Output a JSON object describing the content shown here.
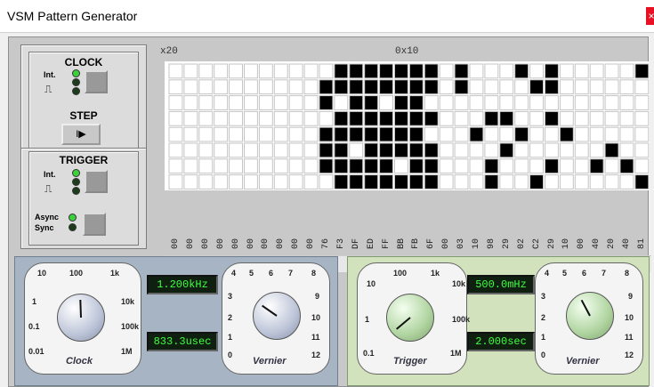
{
  "window": {
    "title": "VSM Pattern Generator",
    "close_glyph": "×"
  },
  "clock": {
    "title": "CLOCK",
    "int_label": "Int.",
    "step_label": "STEP",
    "step_glyph": "I▶"
  },
  "trigger": {
    "title": "TRIGGER",
    "int_label": "Int.",
    "async_label": "Async",
    "sync_label": "Sync"
  },
  "grid": {
    "left_label": "x20",
    "center_label": "0x10",
    "hex_columns": [
      "00",
      "00",
      "00",
      "00",
      "00",
      "00",
      "00",
      "00",
      "00",
      "00",
      "76",
      "F3",
      "DF",
      "ED",
      "FF",
      "BB",
      "FB",
      "6F",
      "00",
      "03",
      "10",
      "98",
      "29",
      "02",
      "C2",
      "29",
      "10",
      "00",
      "40",
      "20",
      "40",
      "81"
    ],
    "rows": 8,
    "cells": [
      [
        0,
        0,
        0,
        0,
        0,
        0,
        0,
        0,
        0,
        0,
        0,
        1,
        1,
        1,
        1,
        1,
        1,
        1,
        0,
        1,
        0,
        0,
        0,
        1,
        0,
        1,
        0,
        0,
        0,
        0,
        0,
        1
      ],
      [
        0,
        0,
        0,
        0,
        0,
        0,
        0,
        0,
        0,
        0,
        1,
        1,
        1,
        1,
        1,
        1,
        1,
        1,
        0,
        1,
        0,
        0,
        0,
        0,
        1,
        1,
        0,
        0,
        0,
        0,
        0,
        0
      ],
      [
        0,
        0,
        0,
        0,
        0,
        0,
        0,
        0,
        0,
        0,
        1,
        0,
        1,
        1,
        0,
        1,
        1,
        0,
        0,
        0,
        0,
        0,
        0,
        0,
        0,
        0,
        0,
        0,
        0,
        0,
        0,
        0
      ],
      [
        0,
        0,
        0,
        0,
        0,
        0,
        0,
        0,
        0,
        0,
        0,
        1,
        1,
        1,
        1,
        1,
        1,
        1,
        0,
        0,
        0,
        1,
        1,
        0,
        0,
        1,
        0,
        0,
        0,
        0,
        0,
        0
      ],
      [
        0,
        0,
        0,
        0,
        0,
        0,
        0,
        0,
        0,
        0,
        1,
        1,
        1,
        1,
        1,
        1,
        1,
        0,
        0,
        0,
        1,
        0,
        0,
        1,
        0,
        0,
        1,
        0,
        0,
        0,
        0,
        0
      ],
      [
        0,
        0,
        0,
        0,
        0,
        0,
        0,
        0,
        0,
        0,
        1,
        1,
        0,
        1,
        1,
        1,
        1,
        1,
        0,
        0,
        0,
        0,
        1,
        0,
        0,
        0,
        0,
        0,
        0,
        1,
        0,
        0
      ],
      [
        0,
        0,
        0,
        0,
        0,
        0,
        0,
        0,
        0,
        0,
        1,
        1,
        1,
        1,
        1,
        0,
        1,
        1,
        0,
        0,
        0,
        1,
        0,
        0,
        0,
        1,
        0,
        0,
        1,
        0,
        1,
        0
      ],
      [
        0,
        0,
        0,
        0,
        0,
        0,
        0,
        0,
        0,
        0,
        0,
        1,
        1,
        1,
        1,
        1,
        1,
        1,
        0,
        0,
        0,
        1,
        0,
        0,
        1,
        0,
        0,
        0,
        0,
        0,
        0,
        1
      ]
    ]
  },
  "scroll": {
    "left_arrow": "<",
    "right_arrow": ">"
  },
  "clock_dial": {
    "label": "Clock",
    "scale": [
      "10",
      "100",
      "1k",
      "10k",
      "100k",
      "1M",
      "0.01",
      "0.1",
      "1"
    ],
    "freq_display": "1.200kHz",
    "period_display": "833.3usec"
  },
  "clock_vernier": {
    "label": "Vernier",
    "scale": [
      "4",
      "5",
      "6",
      "7",
      "8",
      "9",
      "10",
      "11",
      "12",
      "3",
      "2",
      "1",
      "0"
    ]
  },
  "trigger_dial": {
    "label": "Trigger",
    "scale": [
      "10",
      "100",
      "1k",
      "10k",
      "100k",
      "1M",
      "0.1",
      "1"
    ],
    "freq_display": "500.0mHz",
    "period_display": "2.000sec"
  },
  "trigger_vernier": {
    "label": "Vernier",
    "scale": [
      "4",
      "5",
      "6",
      "7",
      "8",
      "9",
      "10",
      "11",
      "12",
      "3",
      "2",
      "1",
      "0"
    ]
  }
}
